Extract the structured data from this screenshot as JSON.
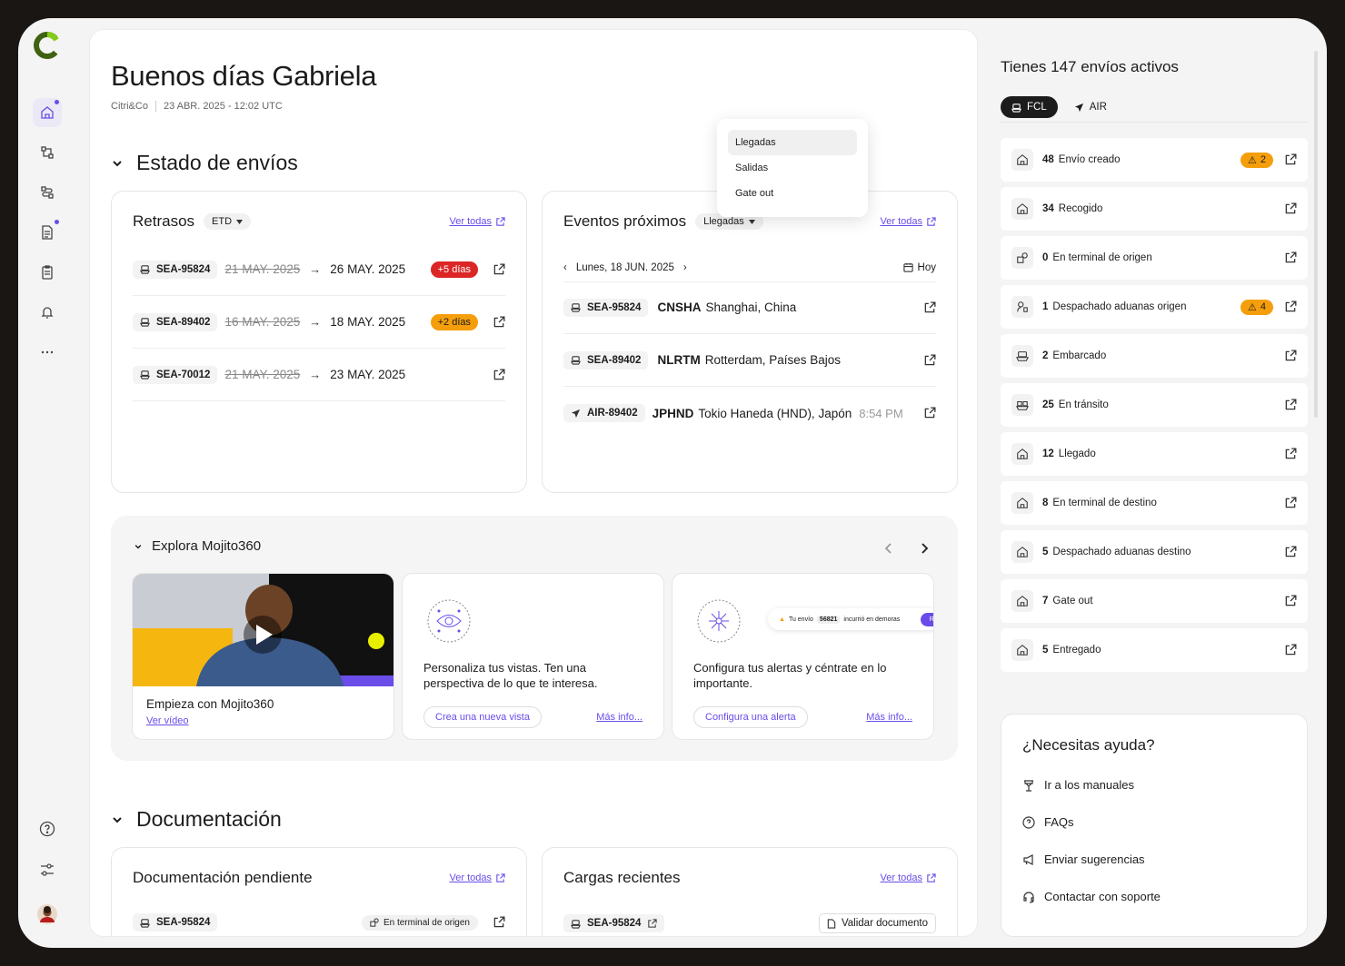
{
  "app": {
    "logo": "mojito-logo"
  },
  "nav": {
    "items": [
      {
        "icon": "home-icon"
      },
      {
        "icon": "shipments-icon"
      },
      {
        "icon": "routes-icon"
      },
      {
        "icon": "document-icon"
      },
      {
        "icon": "clipboard-icon"
      },
      {
        "icon": "bell-icon"
      },
      {
        "icon": "more-icon"
      }
    ],
    "bottom": [
      {
        "icon": "help-icon"
      },
      {
        "icon": "settings-icon"
      },
      {
        "icon": "avatar"
      }
    ]
  },
  "header": {
    "greeting": "Buenos días Gabriela",
    "company": "Citri&Co",
    "datetime": "23 ABR. 2025 - 12:02 UTC"
  },
  "estado": {
    "title": "Estado de envíos"
  },
  "retrasos": {
    "title": "Retrasos",
    "filter": "ETD",
    "ver_todas": "Ver todas",
    "rows": [
      {
        "id": "SEA-95824",
        "old": "21 MAY. 2025",
        "new": "26 MAY. 2025",
        "badge": "+5 días",
        "badge_color": "#dc2626"
      },
      {
        "id": "SEA-89402",
        "old": "16 MAY. 2025",
        "new": "18 MAY. 2025",
        "badge": "+2 días",
        "badge_color": "#f59e0b"
      },
      {
        "id": "SEA-70012",
        "old": "21 MAY. 2025",
        "new": "23 MAY. 2025",
        "badge": "",
        "badge_color": ""
      }
    ]
  },
  "eventos": {
    "title": "Eventos próximos",
    "filter": "Llegadas",
    "ver_todas": "Ver todas",
    "date": "Lunes, 18 JUN. 2025",
    "today": "Hoy",
    "rows": [
      {
        "id": "SEA-95824",
        "code": "CNSHA",
        "place": "Shanghai, China",
        "time": ""
      },
      {
        "id": "SEA-89402",
        "code": "NLRTM",
        "place": "Rotterdam, Países Bajos",
        "time": ""
      },
      {
        "id": "AIR-89402",
        "code": "JPHND",
        "place": "Tokio Haneda (HND), Japón",
        "time": "8:54 PM"
      }
    ]
  },
  "dropdown": {
    "options": [
      "Llegadas",
      "Salidas",
      "Gate out"
    ]
  },
  "explora": {
    "title": "Explora Mojito360",
    "cards": [
      {
        "title": "Empieza con Mojito360",
        "link": "Ver vídeo"
      },
      {
        "text": "Personaliza tus vistas. Ten una perspectiva de lo que te interesa.",
        "button": "Crea una nueva vista",
        "link": "Más info..."
      },
      {
        "text": "Configura tus alertas y céntrate en lo importante.",
        "button": "Configura una alerta",
        "link": "Más info...",
        "toast": {
          "pre": "Tu envío",
          "id": "56821",
          "post": "incurrió en demoras",
          "action": "Reso"
        }
      }
    ]
  },
  "documentacion": {
    "title": "Documentación",
    "pendiente": {
      "title": "Documentación pendiente",
      "ver_todas": "Ver todas",
      "row": {
        "id": "SEA-95824",
        "status": "En terminal de origen"
      }
    },
    "cargas": {
      "title": "Cargas recientes",
      "ver_todas": "Ver todas",
      "row": {
        "id": "SEA-95824",
        "action": "Validar documento"
      }
    }
  },
  "sidebar": {
    "title": "Tienes 147 envíos activos",
    "tabs": [
      "FCL",
      "AIR"
    ],
    "rows": [
      {
        "count": "48",
        "label": "Envío creado",
        "warn": "2",
        "icon": "house-icon"
      },
      {
        "count": "34",
        "label": "Recogido",
        "warn": "",
        "icon": "house-icon"
      },
      {
        "count": "0",
        "label": "En terminal de origen",
        "warn": "",
        "icon": "terminal-icon"
      },
      {
        "count": "1",
        "label": "Despachado aduanas origen",
        "warn": "4",
        "icon": "customs-icon"
      },
      {
        "count": "2",
        "label": "Embarcado",
        "warn": "",
        "icon": "ship-icon"
      },
      {
        "count": "25",
        "label": "En tránsito",
        "warn": "",
        "icon": "transit-icon"
      },
      {
        "count": "12",
        "label": "Llegado",
        "warn": "",
        "icon": "house-icon"
      },
      {
        "count": "8",
        "label": "En terminal de destino",
        "warn": "",
        "icon": "house-icon"
      },
      {
        "count": "5",
        "label": "Despachado aduanas destino",
        "warn": "",
        "icon": "house-icon"
      },
      {
        "count": "7",
        "label": "Gate out",
        "warn": "",
        "icon": "house-icon"
      },
      {
        "count": "5",
        "label": "Entregado",
        "warn": "",
        "icon": "house-icon"
      }
    ]
  },
  "help": {
    "title": "¿Necesitas ayuda?",
    "items": [
      "Ir a los manuales",
      "FAQs",
      "Enviar sugerencias",
      "Contactar con soporte"
    ]
  }
}
